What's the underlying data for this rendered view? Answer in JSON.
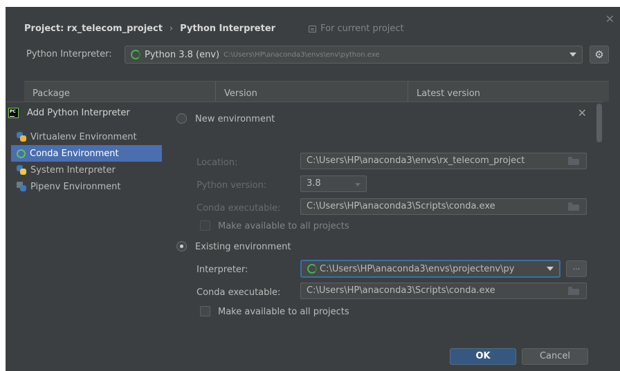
{
  "settings": {
    "breadcrumb": [
      "Project: rx_telecom_project",
      "Python Interpreter"
    ],
    "breadcrumb_separator": "›",
    "scope_label": "For current project",
    "interpreter_label": "Python Interpreter:",
    "interpreter_name": "Python 3.8 (env)",
    "interpreter_path": "C:\\Users\\HP\\anaconda3\\envs\\env\\python.exe",
    "table_headers": [
      "Package",
      "Version",
      "Latest version"
    ],
    "close_glyph": "✕",
    "gear_glyph": "⚙"
  },
  "dialog": {
    "title": "Add Python Interpreter",
    "close_glyph": "✕",
    "sidebar": [
      {
        "label": "Virtualenv Environment",
        "icon": "virtualenv-icon",
        "selected": false
      },
      {
        "label": "Conda Environment",
        "icon": "conda-icon",
        "selected": true
      },
      {
        "label": "System Interpreter",
        "icon": "python-icon",
        "selected": false
      },
      {
        "label": "Pipenv Environment",
        "icon": "pipenv-icon",
        "selected": false
      }
    ],
    "new_env": {
      "radio_label": "New environment",
      "selected": false,
      "location_label": "Location:",
      "location_value": "C:\\Users\\HP\\anaconda3\\envs\\rx_telecom_project",
      "python_version_label": "Python version:",
      "python_version_value": "3.8",
      "conda_exec_label": "Conda executable:",
      "conda_exec_value": "C:\\Users\\HP\\anaconda3\\Scripts\\conda.exe",
      "make_available_label": "Make available to all projects"
    },
    "existing_env": {
      "radio_label": "Existing environment",
      "selected": true,
      "interpreter_label": "Interpreter:",
      "interpreter_value": "C:\\Users\\HP\\anaconda3\\envs\\projectenv\\py",
      "browse_label": "...",
      "conda_exec_label": "Conda executable:",
      "conda_exec_value": "C:\\Users\\HP\\anaconda3\\Scripts\\conda.exe",
      "make_available_label": "Make available to all projects"
    },
    "ok_label": "OK",
    "cancel_label": "Cancel"
  },
  "colors": {
    "background": "#3c3f41",
    "selection": "#4b6eaf",
    "primary_button": "#365880",
    "focus_border": "#3d6fa8",
    "conda_green": "#4caf50"
  }
}
